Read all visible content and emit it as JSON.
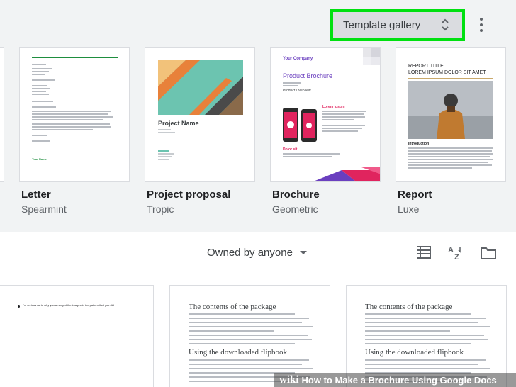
{
  "toolbar": {
    "template_gallery_label": "Template gallery"
  },
  "templates": [
    {
      "name": "Letter",
      "style": "Spearmint",
      "footer": "Your Name"
    },
    {
      "name": "Project proposal",
      "style": "Tropic",
      "project_name": "Project Name"
    },
    {
      "name": "Brochure",
      "style": "Geometric",
      "company": "Your Company",
      "heading": "Product Brochure",
      "overview": "Product Overview",
      "lorem": "Lorem ipsum",
      "dolor": "Dolor sit"
    },
    {
      "name": "Report",
      "style": "Luxe",
      "report_title": "REPORT TITLE",
      "report_subtitle": "LOREM IPSUM DOLOR SIT AMET",
      "intro": "Introduction"
    }
  ],
  "filter": {
    "owned_label": "Owned by anyone"
  },
  "documents": [
    {
      "first_line": "I'm curious as to why you arranged the images in the pattern that you did"
    },
    {
      "title": "The contents of the package",
      "section": "Using the downloaded flipbook"
    },
    {
      "title": "The contents of the package",
      "section": "Using the downloaded flipbook"
    }
  ],
  "watermark": {
    "brand": "wiki",
    "text": "How to Make a Brochure Using Google Docs"
  },
  "colors": {
    "highlight": "#00e010",
    "spearmint": "#1e8e3e",
    "tropic_teal": "#6cc4b0",
    "tropic_orange": "#e8813a",
    "geometric_pink": "#e0245e",
    "geometric_purple": "#6a3fbf"
  },
  "icons": [
    "unfold-icon",
    "more-vert-icon",
    "list-view-icon",
    "sort-az-icon",
    "folder-icon"
  ]
}
